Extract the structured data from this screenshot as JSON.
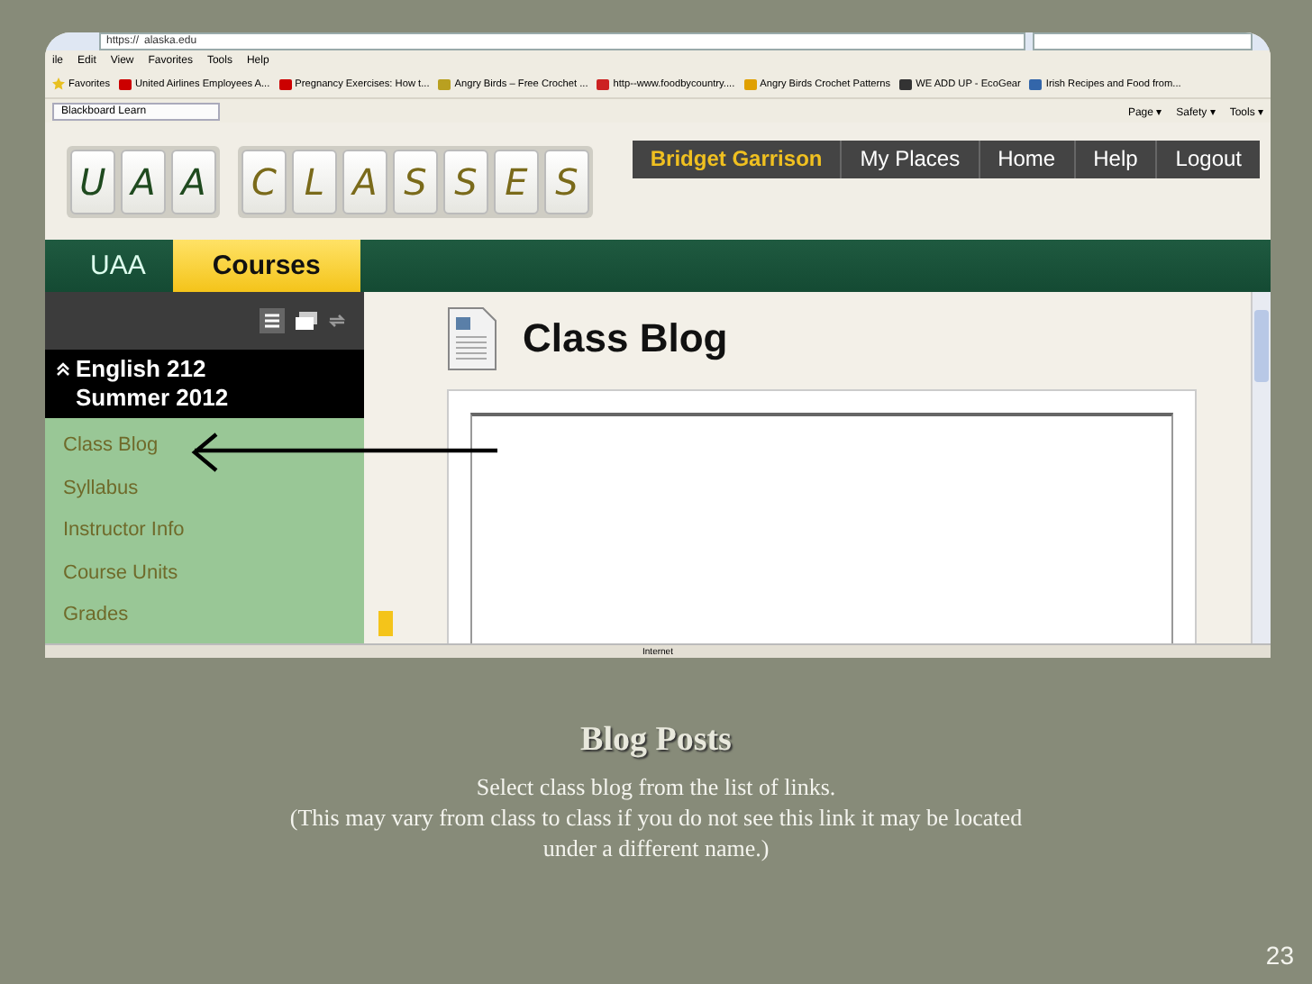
{
  "browser": {
    "address": "https://",
    "domain": "alaska.edu",
    "menu": [
      "ile",
      "Edit",
      "View",
      "Favorites",
      "Tools",
      "Help"
    ],
    "favorites_label": "Favorites",
    "favorites": [
      "United Airlines Employees A...",
      "Pregnancy Exercises: How t...",
      "Angry Birds – Free Crochet ...",
      "http--www.foodbycountry....",
      "Angry Birds Crochet Patterns",
      "WE ADD UP - EcoGear",
      "Irish Recipes and Food from..."
    ],
    "tab": "Blackboard Learn",
    "commands": [
      "Page ▾",
      "Safety ▾",
      "Tools ▾"
    ],
    "status": "Internet"
  },
  "site": {
    "logo_words": [
      [
        "U",
        "A",
        "A"
      ],
      [
        "C",
        "L",
        "A",
        "S",
        "S",
        "E",
        "S"
      ]
    ],
    "user": "Bridget Garrison",
    "top_links": [
      "My Places",
      "Home",
      "Help",
      "Logout"
    ],
    "tabs": [
      {
        "label": "UAA",
        "selected": false
      },
      {
        "label": "Courses",
        "selected": true
      }
    ]
  },
  "sidebar": {
    "course": [
      "English 212",
      "Summer 2012"
    ],
    "items": [
      {
        "label": "Class Blog",
        "selected": false
      },
      {
        "label": "Syllabus",
        "selected": false
      },
      {
        "label": "Instructor Info",
        "selected": false
      },
      {
        "label": "Course Units",
        "selected": false
      },
      {
        "label": "Grades",
        "selected": false
      }
    ]
  },
  "content": {
    "title": "Class Blog"
  },
  "slide": {
    "title": "Blog Posts",
    "instruction": "Select class blog from the list of links.",
    "note": "(This may vary from class to class if you do not see this link it may be located under a different name.)",
    "page": "23"
  }
}
